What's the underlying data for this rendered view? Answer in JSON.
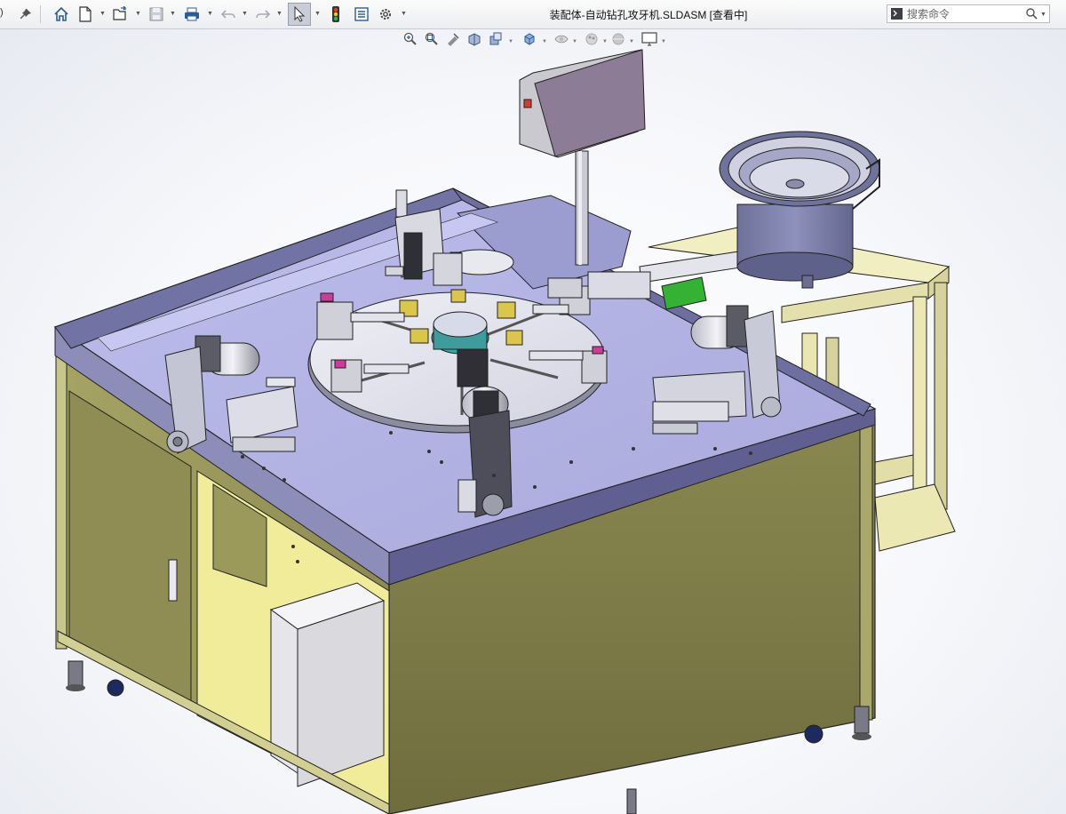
{
  "app": {
    "menu_stub": "\u0019)",
    "document_title": "装配体-自动钻孔攻牙机.SLDASM [查看中]"
  },
  "toolbar": {
    "icons": [
      "pin-icon",
      "home-icon",
      "new-document-icon",
      "open-file-icon",
      "save-icon",
      "print-icon",
      "undo-icon",
      "redo-icon",
      "select-cursor-icon",
      "rebuild-traffic-light-icon",
      "file-properties-icon",
      "options-gear-icon"
    ]
  },
  "search": {
    "placeholder": "搜索命令"
  },
  "headsup_toolbar": {
    "icons": [
      "zoom-to-fit-icon",
      "zoom-to-area-icon",
      "previous-view-icon",
      "section-view-icon",
      "view-orientation-icon",
      "display-style-icon",
      "hide-show-items-icon",
      "edit-appearance-icon",
      "apply-scene-icon",
      "view-settings-icon"
    ]
  },
  "model": {
    "name": "自动钻孔攻牙机",
    "colors": {
      "table_top": "#b7b8e6",
      "cabinet_body": "#7e7c46",
      "cabinet_side": "#9b9959",
      "side_stand": "#ece9b7",
      "indexing_plate": "#e3e3ec",
      "control_panel": "#8d7c96",
      "bowl_feeder": "#7679a0",
      "accent_magenta": "#cc3d99",
      "accent_green": "#33b233"
    }
  }
}
